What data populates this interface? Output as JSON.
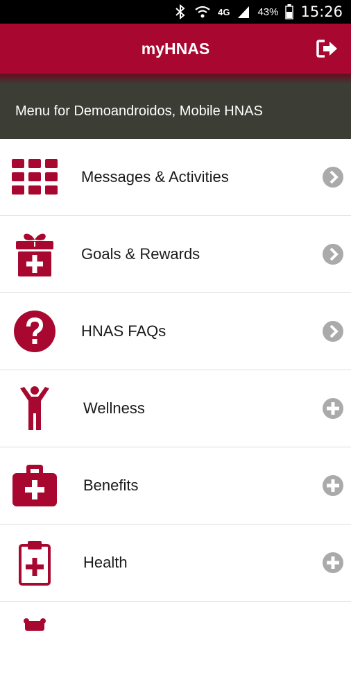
{
  "status": {
    "battery": "43%",
    "time": "15:26",
    "network": "4G"
  },
  "app": {
    "title": "myHNAS"
  },
  "subheader": {
    "text": "Menu for Demoandroidos, Mobile HNAS"
  },
  "menu": {
    "items": [
      {
        "label": "Messages & Activities",
        "icon": "grid-icon",
        "action": "chevron-right"
      },
      {
        "label": "Goals & Rewards",
        "icon": "gift-icon",
        "action": "chevron-right"
      },
      {
        "label": "HNAS FAQs",
        "icon": "question-icon",
        "action": "chevron-right"
      },
      {
        "label": "Wellness",
        "icon": "person-icon",
        "action": "plus"
      },
      {
        "label": "Benefits",
        "icon": "medkit-icon",
        "action": "plus"
      },
      {
        "label": "Health",
        "icon": "clipboard-icon",
        "action": "plus"
      }
    ]
  },
  "colors": {
    "brand": "#a8082f",
    "subheader_bg": "#3c3d35",
    "action_icon": "#aaaaaa"
  }
}
